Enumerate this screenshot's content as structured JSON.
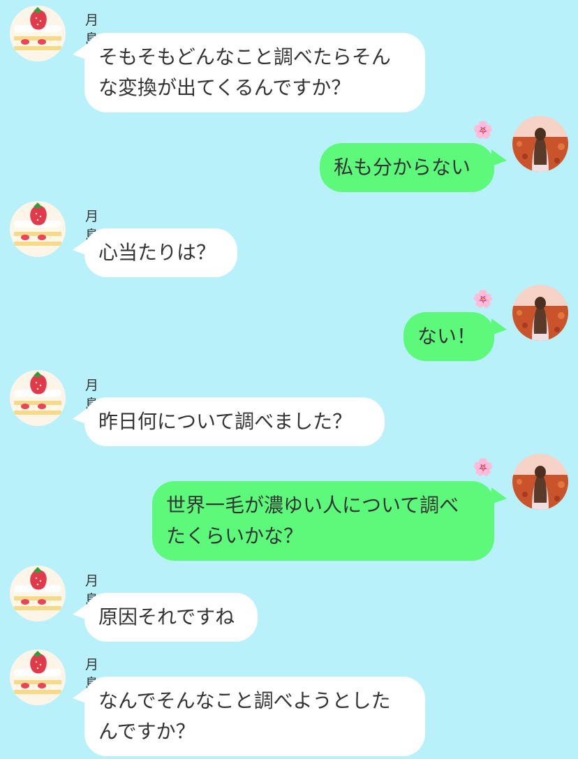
{
  "chat": {
    "contact_name": "月島蛍",
    "self_badge_emoji": "🌸",
    "messages": [
      {
        "side": "in",
        "name": "月島蛍",
        "text": "そもそもどんなこと調べたらそん\nな変換が出てくるんですか？"
      },
      {
        "side": "out",
        "text": "私も分からない"
      },
      {
        "side": "in",
        "name": "月島蛍",
        "text": "心当たりは？"
      },
      {
        "side": "out",
        "text": "ない！"
      },
      {
        "side": "in",
        "name": "月島蛍",
        "text": "昨日何について調べました？"
      },
      {
        "side": "out",
        "text": "世界一毛が濃ゆい人について調べ\nたくらいかな？"
      },
      {
        "side": "in",
        "name": "月島蛍",
        "text": "原因それですね"
      },
      {
        "side": "in",
        "name": "月島蛍",
        "text": "なんでそんなこと調べようとした\nんですか？"
      }
    ]
  },
  "colors": {
    "background": "#b9f1fb",
    "incoming_bubble": "#ffffff",
    "outgoing_bubble": "#5df97b"
  },
  "icons": {
    "contact_avatar": "strawberry-shortcake-icon",
    "self_avatar": "girl-in-flower-field-icon"
  }
}
